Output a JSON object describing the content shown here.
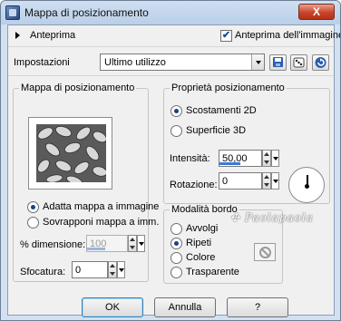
{
  "window": {
    "title": "Mappa di posizionamento",
    "close_label": "X"
  },
  "preview_bar": {
    "label": "Anteprima",
    "preview_image_label": "Anteprima dell'immagine",
    "preview_image_checked": true
  },
  "settings": {
    "label": "Impostazioni",
    "preset_value": "Ultimo utilizzo"
  },
  "map_group": {
    "title": "Mappa di posizionamento",
    "radio_fit": "Adatta mappa a immagine",
    "radio_fit_selected": true,
    "radio_overlay": "Sovrapponi mappa a imm.",
    "dimension_label": "% dimensione:",
    "dimension_value": "100",
    "blur_label": "Sfocatura:",
    "blur_value": "0"
  },
  "properties_group": {
    "title": "Proprietà posizionamento",
    "radio_2d": "Scostamenti 2D",
    "radio_2d_selected": true,
    "radio_3d": "Superficie 3D",
    "intensity_label": "Intensità:",
    "intensity_value": "50,00",
    "intensity_level_percent": 50,
    "rotation_label": "Rotazione:",
    "rotation_value": "0"
  },
  "edge_group": {
    "title": "Modalità bordo",
    "radio_wrap": "Avvolgi",
    "radio_repeat": "Ripeti",
    "radio_repeat_selected": true,
    "radio_color": "Colore",
    "radio_transparent": "Trasparente"
  },
  "watermark": "Paolapaola",
  "buttons": {
    "ok": "OK",
    "cancel": "Annulla",
    "help": "?"
  },
  "colors": {
    "accent": "#3b7bd6",
    "title_bar": "#c3d7ee",
    "close": "#c8452a"
  }
}
